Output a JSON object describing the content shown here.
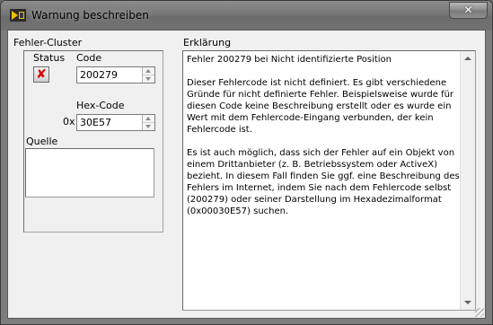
{
  "window": {
    "title": "Warnung beschreiben",
    "close_glyph": "✕"
  },
  "cluster": {
    "label": "Fehler-Cluster",
    "status_label": "Status",
    "status_glyph": "✘",
    "status_color": "#d60000",
    "code_label": "Code",
    "code_value": "200279",
    "hex_label": "Hex-Code",
    "hex_prefix": "0x",
    "hex_value": "30E57",
    "source_label": "Quelle",
    "source_value": ""
  },
  "explanation": {
    "label": "Erklärung",
    "heading": "Fehler 200279 bei Nicht identifizierte Position",
    "para1": "Dieser Fehlercode ist nicht definiert. Es gibt verschiedene Gründe für nicht definierte Fehler. Beispielsweise wurde für diesen Code keine Beschreibung erstellt oder es wurde ein Wert mit dem Fehlercode-Eingang verbunden, der kein Fehlercode ist.",
    "para2": "Es ist auch möglich, dass sich der Fehler auf ein Objekt von einem Drittanbieter (z. B. Betriebssystem oder ActiveX) bezieht. In diesem Fall finden Sie ggf. eine Beschreibung des Fehlers im Internet, indem Sie nach dem Fehlercode selbst (200279) oder seiner Darstellung im Hexadezimalformat (0x00030E57) suchen."
  },
  "icons": {
    "app_icon": "labview-vi-icon",
    "close": "close-icon",
    "status": "error-x-icon",
    "spin_up": "arrow-up-icon",
    "spin_down": "arrow-down-icon",
    "resize": "resize-grip-icon"
  }
}
